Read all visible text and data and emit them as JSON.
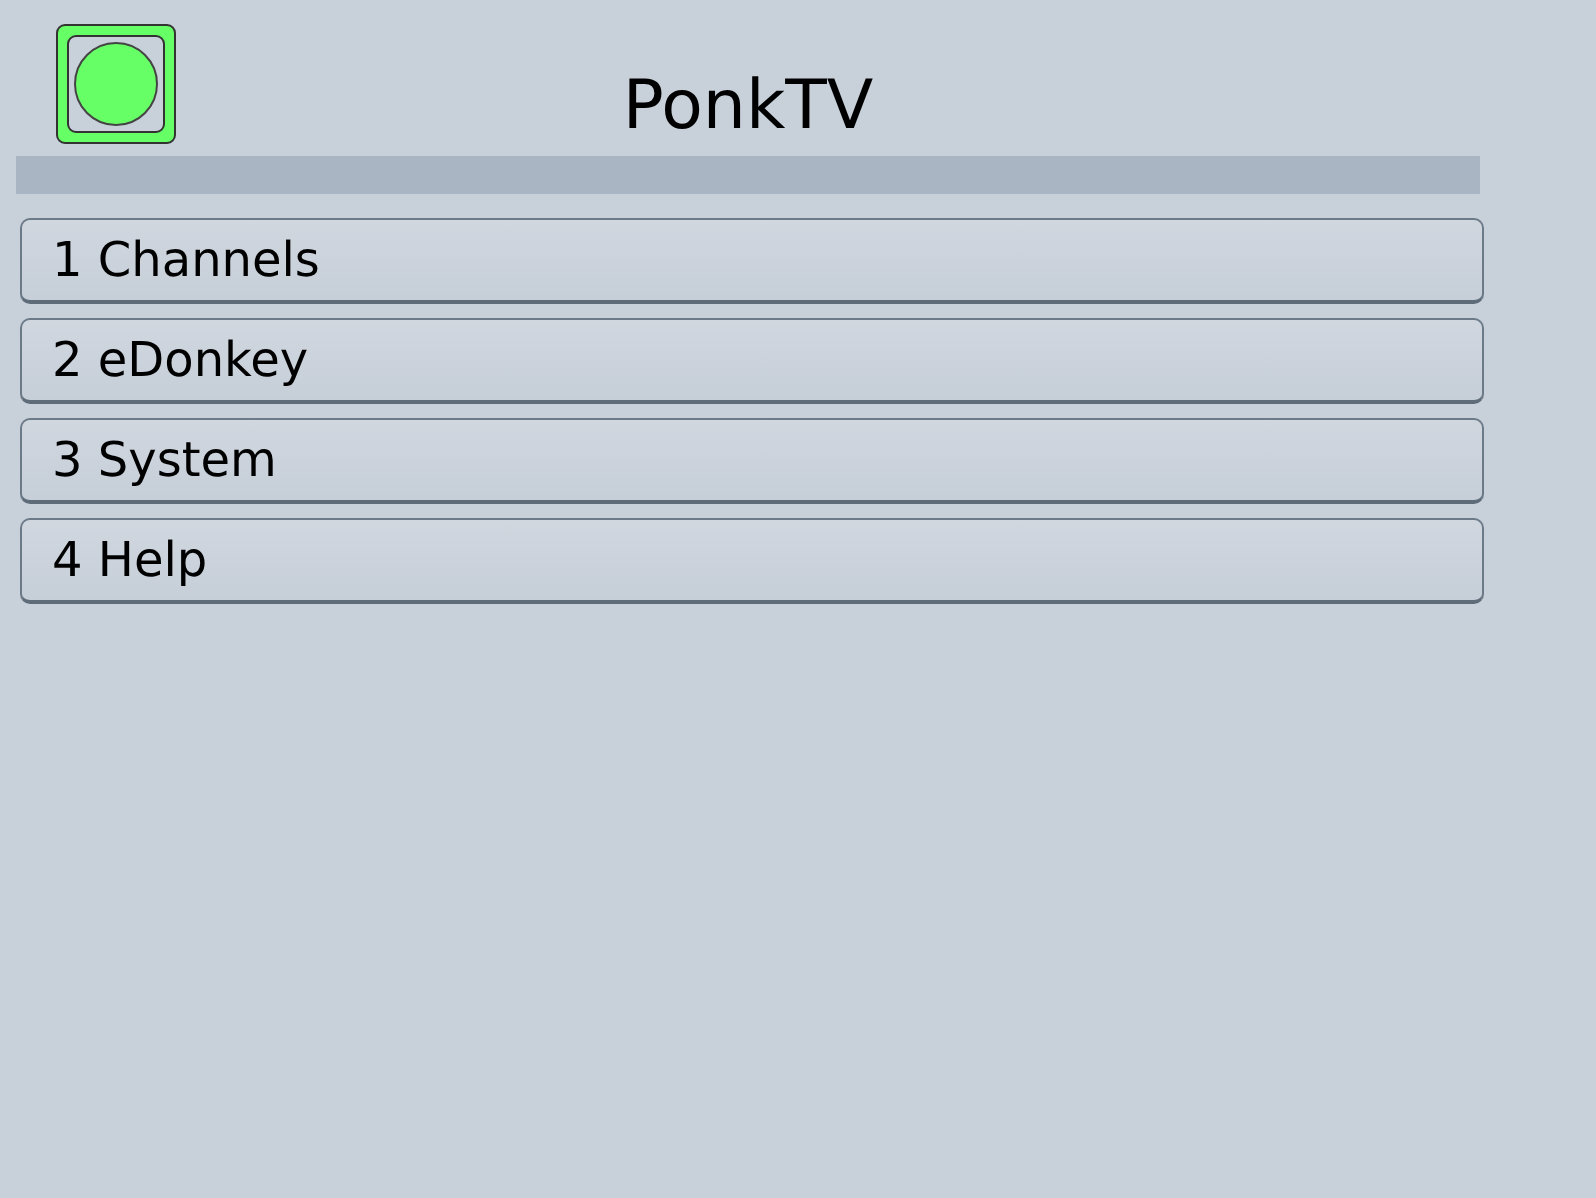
{
  "title": "PonkTV",
  "menu": [
    {
      "label": "1 Channels"
    },
    {
      "label": "2 eDonkey"
    },
    {
      "label": "3 System"
    },
    {
      "label": "4 Help"
    }
  ]
}
